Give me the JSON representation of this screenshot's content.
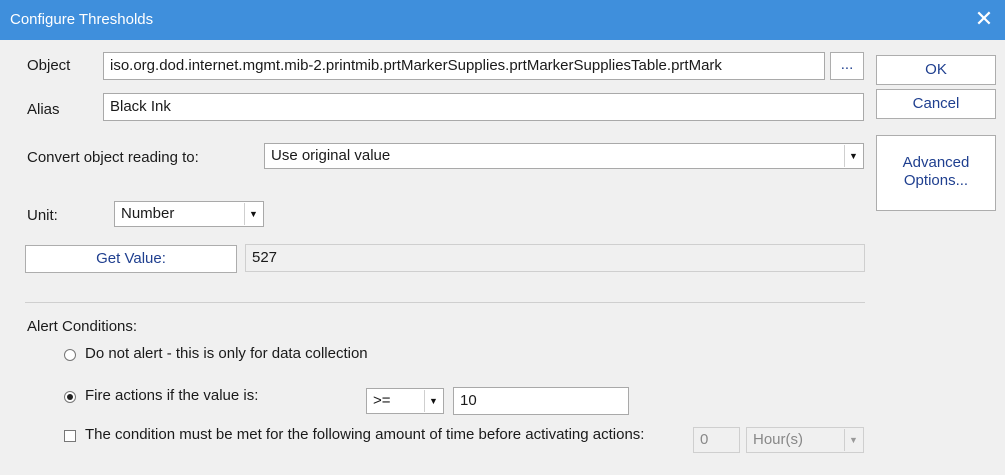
{
  "window": {
    "title": "Configure Thresholds",
    "close_glyph": "✕"
  },
  "object": {
    "label": "Object",
    "value": "iso.org.dod.internet.mgmt.mib-2.printmib.prtMarkerSupplies.prtMarkerSuppliesTable.prtMark",
    "browse_label": "..."
  },
  "alias": {
    "label": "Alias",
    "value": "Black Ink"
  },
  "convert": {
    "label": "Convert object reading to:",
    "value": "Use original value"
  },
  "unit": {
    "label": "Unit:",
    "value": "Number"
  },
  "get_value": {
    "button_label": "Get Value:",
    "result": "527"
  },
  "buttons": {
    "ok": "OK",
    "cancel": "Cancel",
    "advanced": "Advanced Options..."
  },
  "alert": {
    "heading": "Alert Conditions:",
    "option_no_alert": "Do not alert - this is only for data collection",
    "option_fire": "Fire actions if the value is:",
    "selected_option": "fire",
    "operator": "&gt;=",
    "threshold": "10",
    "duration_label": "The condition must be met for the following amount of time before activating actions:",
    "duration_checked": false,
    "duration_value": "0",
    "duration_unit": "Hour(s)"
  },
  "icons": {
    "dropdown": "dropdown-arrow-icon",
    "close": "close-icon"
  }
}
